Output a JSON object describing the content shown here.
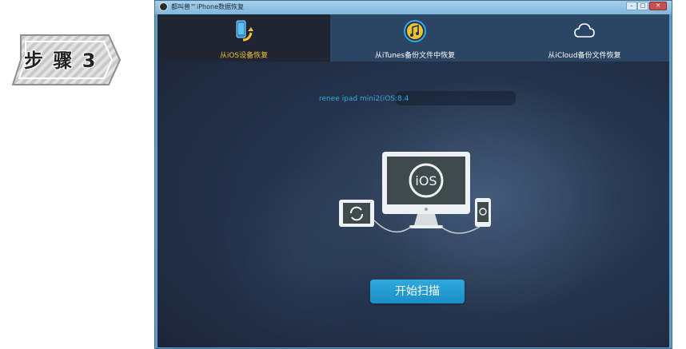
{
  "step_badge": {
    "label": "步 骤 3"
  },
  "window": {
    "title": "都叫兽™iPhone数据恢复",
    "controls": {
      "minimize": "–",
      "maximize": "□",
      "close": "✕"
    }
  },
  "tabs": [
    {
      "label": "从iOS设备恢复",
      "icon": "phone-restore-icon",
      "active": true
    },
    {
      "label": "从iTunes备份文件中恢复",
      "icon": "itunes-music-icon",
      "active": false
    },
    {
      "label": "从iCloud备份文件恢复",
      "icon": "cloud-icon",
      "active": false
    }
  ],
  "device": {
    "info": "renee ipad mini2(iOS:8.4"
  },
  "illustration": {
    "monitor_text": "iOS"
  },
  "actions": {
    "start_scan": "开始扫描"
  },
  "colors": {
    "active_tab": "#f0c230",
    "accent": "#1b8fc6",
    "info_text": "#35a8e0"
  }
}
